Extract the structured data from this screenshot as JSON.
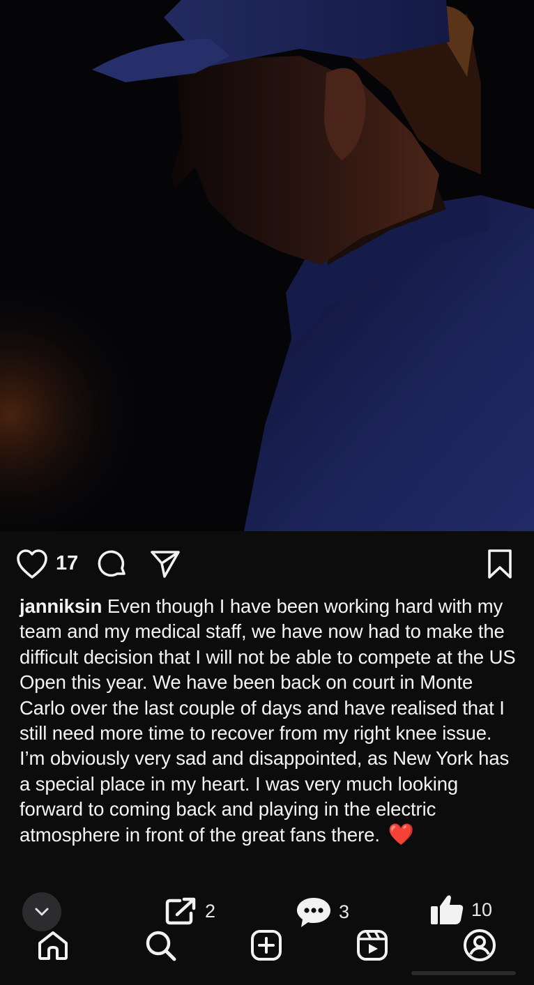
{
  "post": {
    "like_count": "17",
    "username": "janniksin",
    "caption": "Even though I have been working hard with my team and my medical staff, we have now had to make the difficult decision that I will not be able to compete at the US Open this year. We have been back on court in Monte Carlo over the last couple of days and have realised that I still need more time to recover from my right knee issue. I’m obviously very sad and disappointed, as New York has a special place in my heart. I was very much looking forward to coming back and playing in the electric atmosphere in front of the great fans there.",
    "emoji": "❤️"
  },
  "stats": {
    "share_count": "2",
    "comment_count": "3",
    "like_count": "10"
  },
  "icons": {
    "like": "heart-outline-icon",
    "comment": "comment-bubble-icon",
    "share": "paper-plane-icon",
    "save": "bookmark-icon",
    "collapse": "chevron-down-icon",
    "external_share": "share-out-icon",
    "comments_stat": "speech-bubble-icon",
    "thumbs_up": "thumbs-up-icon",
    "nav_home": "home-icon",
    "nav_search": "search-icon",
    "nav_create": "plus-square-icon",
    "nav_reels": "reels-icon",
    "nav_profile": "profile-icon"
  },
  "colors": {
    "background": "#0c0c0d",
    "text": "#f4f4f4",
    "heart": "#e8282b",
    "cap_shirt": "#1c2358"
  }
}
